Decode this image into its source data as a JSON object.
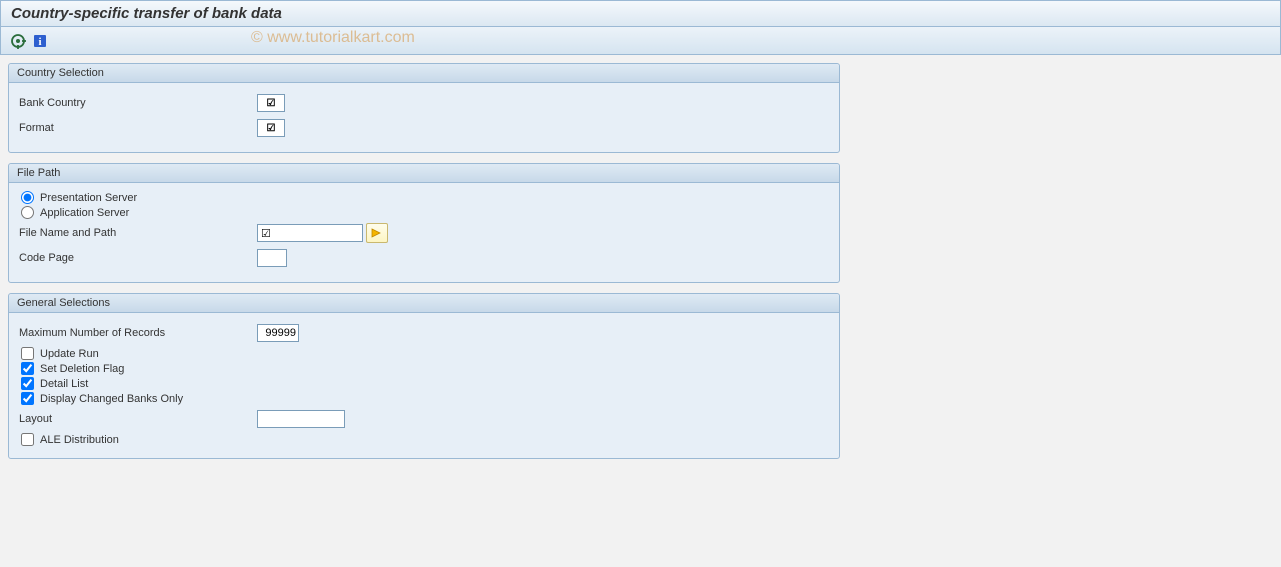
{
  "title": "Country-specific transfer of bank data",
  "watermark": "© www.tutorialkart.com",
  "icons": {
    "execute": "execute-icon",
    "info": "info-icon"
  },
  "groups": {
    "country": {
      "title": "Country Selection",
      "bank_country": {
        "label": "Bank Country",
        "value": "☑"
      },
      "format": {
        "label": "Format",
        "value": "☑"
      }
    },
    "file": {
      "title": "File Path",
      "radio_presentation": {
        "label": "Presentation Server",
        "checked": true
      },
      "radio_application": {
        "label": "Application Server",
        "checked": false
      },
      "file_name": {
        "label": "File Name and Path",
        "value": "☑"
      },
      "code_page": {
        "label": "Code Page",
        "value": ""
      }
    },
    "general": {
      "title": "General Selections",
      "max_records": {
        "label": "Maximum Number of Records",
        "value": "99999"
      },
      "update_run": {
        "label": "Update Run",
        "checked": false
      },
      "set_deletion": {
        "label": "Set Deletion Flag",
        "checked": true
      },
      "detail_list": {
        "label": "Detail List",
        "checked": true
      },
      "display_changed": {
        "label": "Display Changed Banks Only",
        "checked": true
      },
      "layout": {
        "label": "Layout",
        "value": ""
      },
      "ale": {
        "label": "ALE Distribution",
        "checked": false
      }
    }
  }
}
